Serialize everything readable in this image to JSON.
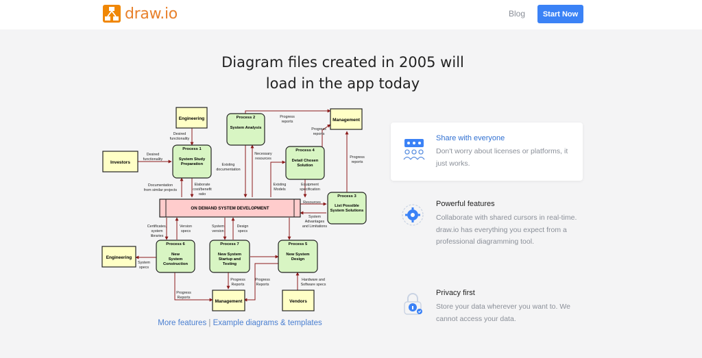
{
  "nav": {
    "brand": "draw.io",
    "blog": "Blog",
    "start": "Start Now"
  },
  "hero": {
    "line1": "Diagram files created in 2005 will",
    "line2": "load in the app today"
  },
  "links": {
    "more": "More features",
    "separator": " | ",
    "examples": "Example diagrams & templates"
  },
  "features": [
    {
      "title": "Share with everyone",
      "desc": "Don't worry about licenses or platforms, it just works.",
      "icon": "share-people-icon"
    },
    {
      "title": "Powerful features",
      "desc": "Collaborate with shared cursors in real-time. draw.io has everything you expect from a professional diagramming tool.",
      "icon": "gear-icon"
    },
    {
      "title": "Privacy first",
      "desc": "Store your data wherever you want to. We cannot access your data.",
      "icon": "lock-icon"
    }
  ],
  "diagram": {
    "nodes": {
      "engineering_top": "Engineering",
      "process2_title": "Process 2",
      "process2_label": "System Analysis",
      "management_top": "Management",
      "investors": "Investors",
      "process1_title": "Process 1",
      "process1_label_1": "System Study",
      "process1_label_2": "Preparation",
      "process4_title": "Process 4",
      "process4_label_1": "Detail Chosen",
      "process4_label_2": "Solution",
      "process3_title": "Process 3",
      "process3_label_1": "List Possible",
      "process3_label_2": "System Solutions",
      "central": "ON DEMAND SYSTEM DEVELOPMENT",
      "engineering_bottom": "Engineering",
      "process6_title": "Process 6",
      "process6_label_1": "New",
      "process6_label_2": "System",
      "process6_label_3": "Construction",
      "process7_title": "Process 7",
      "process7_label_1": "New System",
      "process7_label_2": "Startup and",
      "process7_label_3": "Testing",
      "process5_title": "Process 5",
      "process5_label_1": "New System",
      "process5_label_2": "Design",
      "management_bottom": "Management",
      "vendors": "Vendors"
    },
    "labels": {
      "progress_reports_top_1": "Progress",
      "progress_reports_top_2": "reports",
      "desired_func_1": "Desired",
      "desired_func_2": "functionality",
      "desired_func_b_1": "Desired",
      "desired_func_b_2": "functionality",
      "necessary_res_1": "Necessary",
      "necessary_res_2": "resources",
      "progress_reports_p4_1": "Progress",
      "progress_reports_p4_2": "reports",
      "progress_reports_p3_1": "Progress",
      "progress_reports_p3_2": "reports",
      "existing_doc_1": "Existing",
      "existing_doc_2": "documentation",
      "doc_similar_1": "Documentation",
      "doc_similar_2": "from similar projects",
      "elaborate_1": "Elaborate",
      "elaborate_2": "cost/benefit",
      "elaborate_3": "ratio",
      "existing_models_1": "Existing",
      "existing_models_2": "Models",
      "equipment_1": "Equipment",
      "equipment_2": "specification",
      "resources": "Resources",
      "system_adv_1": "System",
      "system_adv_2": "Advantages",
      "system_adv_3": "and Limitations",
      "certificates_1": "Certificates,",
      "certificates_2": "system",
      "certificates_3": "libraries",
      "version_specs_1": "Version",
      "version_specs_2": "specs",
      "system_version_1": "System",
      "system_version_2": "version",
      "design_specs_1": "Design",
      "design_specs_2": "specs",
      "system_specs_1": "System",
      "system_specs_2": "specs",
      "progress_reports_p6_1": "Progress",
      "progress_reports_p6_2": "Reports",
      "progress_reports_p7_1": "Progress",
      "progress_reports_p7_2": "Reports",
      "progress_reports_p5_1": "Progress",
      "progress_reports_p5_2": "Reports",
      "hardware_1": "Hardware and",
      "hardware_2": "Software specs"
    }
  }
}
